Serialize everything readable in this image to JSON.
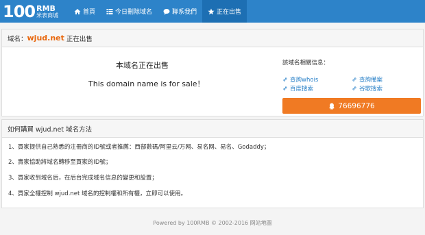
{
  "logo": {
    "big": "100",
    "rmb": "RMB",
    "sub": "米表商城"
  },
  "nav": [
    {
      "label": "首頁",
      "icon": "home-icon",
      "active": false
    },
    {
      "label": "今日刪除域名",
      "icon": "list-icon",
      "active": false
    },
    {
      "label": "聯系我們",
      "icon": "chat-icon",
      "active": false
    },
    {
      "label": "正在出售",
      "icon": "star-icon",
      "active": true
    }
  ],
  "sale_panel": {
    "head_prefix": "域名：",
    "domain": "wjud.net",
    "head_suffix": "正在出售",
    "title_zh": "本域名正在出售",
    "title_en": "This domain name is for sale！",
    "info_title": "該域名相關信息：",
    "links": [
      {
        "label": "查詢whois",
        "icon": "link-icon"
      },
      {
        "label": "查詢備案",
        "icon": "link-icon"
      },
      {
        "label": "百度搜索",
        "icon": "link-icon"
      },
      {
        "label": "谷歌搜索",
        "icon": "link-icon"
      }
    ],
    "qq": {
      "number": "76696776",
      "icon": "qq-icon"
    }
  },
  "method_panel": {
    "title": "如何購買 wjud.net 域名方法",
    "steps": [
      "1、買家提供自己熟悉的注冊商的ID號或者推薦：西部數碼/阿里云/万网、易名网、易名、Godaddy；",
      "2、賣家協助將域名轉移至買家的ID號；",
      "3、買家收到域名后，在后台完成域名信息的變更和設置；",
      "4、買家全權控制 wjud.net 域名的控制權和所有權，立即可以使用。"
    ]
  },
  "footer": {
    "text": "Powered by 100RMB © 2002-2016 网站地圖"
  }
}
